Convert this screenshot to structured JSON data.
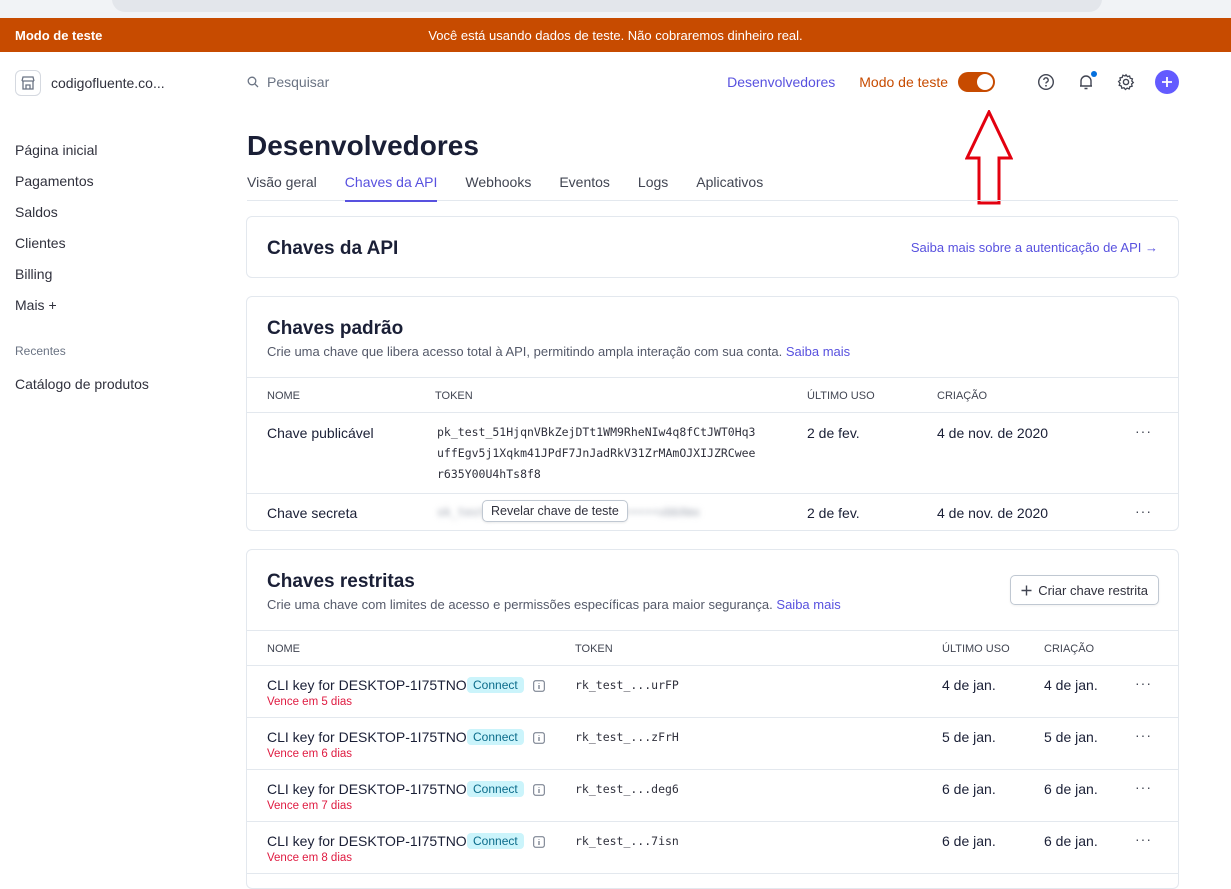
{
  "banner": {
    "label": "Modo de teste",
    "message": "Você está usando dados de teste. Não cobraremos dinheiro real."
  },
  "account": {
    "name": "codigofluente.co..."
  },
  "sidebar": {
    "items": [
      {
        "label": "Página inicial"
      },
      {
        "label": "Pagamentos"
      },
      {
        "label": "Saldos"
      },
      {
        "label": "Clientes"
      },
      {
        "label": "Billing"
      },
      {
        "label": "Mais +"
      }
    ],
    "recent_heading": "Recentes",
    "recent_items": [
      {
        "label": "Catálogo de produtos"
      }
    ]
  },
  "topbar": {
    "search_placeholder": "Pesquisar",
    "developers_link": "Desenvolvedores",
    "test_mode_label": "Modo de teste",
    "test_mode_on": true
  },
  "page": {
    "title": "Desenvolvedores",
    "tabs": [
      {
        "label": "Visão geral",
        "active": false
      },
      {
        "label": "Chaves da API",
        "active": true
      },
      {
        "label": "Webhooks",
        "active": false
      },
      {
        "label": "Eventos",
        "active": false
      },
      {
        "label": "Logs",
        "active": false
      },
      {
        "label": "Aplicativos",
        "active": false
      }
    ]
  },
  "api_card": {
    "title": "Chaves da API",
    "link": "Saiba mais sobre a autenticação de API →"
  },
  "standard_keys": {
    "title": "Chaves padrão",
    "description": "Crie uma chave que libera acesso total à API, permitindo ampla interação com sua conta.",
    "learn_more": "Saiba mais",
    "columns": {
      "name": "NOME",
      "token": "TOKEN",
      "last_used": "ÚLTIMO USO",
      "created": "CRIAÇÃO"
    },
    "rows": [
      {
        "name": "Chave publicável",
        "token_lines": [
          "pk_test_51HjqnVBkZejDTt1WM9RheNIw4q8fCtJWT0Hq3",
          "uffEgv5j1Xqkm41JPdF7JnJadRkV31ZrMAmOJXIJZRCwee",
          "r635Y00U4hTs8f8"
        ],
        "last_used": "2 de fev.",
        "created": "4 de nov. de 2020",
        "menu": "···"
      },
      {
        "name": "Chave secreta",
        "token_blurred": "sk_test_••••••••••••••••••••••••xbbXmx",
        "reveal_label": "Revelar chave de teste",
        "last_used": "2 de fev.",
        "created": "4 de nov. de 2020",
        "menu": "···"
      }
    ]
  },
  "restricted_keys": {
    "title": "Chaves restritas",
    "description": "Crie uma chave com limites de acesso e permissões específicas para maior segurança.",
    "learn_more": "Saiba mais",
    "create_label": "Criar chave restrita",
    "columns": {
      "name": "NOME",
      "token": "TOKEN",
      "last_used": "ÚLTIMO USO",
      "created": "CRIAÇÃO"
    },
    "rows": [
      {
        "name": "CLI key for DESKTOP-1I75TNO",
        "badge": "Connect",
        "expires": "Vence em 5 dias",
        "token": "rk_test_...urFP",
        "last_used": "4 de jan.",
        "created": "4 de jan.",
        "menu": "···"
      },
      {
        "name": "CLI key for DESKTOP-1I75TNO",
        "badge": "Connect",
        "expires": "Vence em 6 dias",
        "token": "rk_test_...zFrH",
        "last_used": "5 de jan.",
        "created": "5 de jan.",
        "menu": "···"
      },
      {
        "name": "CLI key for DESKTOP-1I75TNO",
        "badge": "Connect",
        "expires": "Vence em 7 dias",
        "token": "rk_test_...deg6",
        "last_used": "6 de jan.",
        "created": "6 de jan.",
        "menu": "···"
      },
      {
        "name": "CLI key for DESKTOP-1I75TNO",
        "badge": "Connect",
        "expires": "Vence em 8 dias",
        "token": "rk_test_...7isn",
        "last_used": "6 de jan.",
        "created": "6 de jan.",
        "menu": "···"
      }
    ]
  },
  "colors": {
    "test_mode": "#c74b00",
    "accent": "#5851df",
    "plus_button": "#635bff",
    "expire_text": "#df1b41",
    "badge_bg": "#cbf4fb",
    "annotation_arrow": "#e3000f"
  },
  "icons": [
    "store-icon",
    "search-icon",
    "toggle-switch",
    "help-icon",
    "bell-icon",
    "gear-icon",
    "plus-icon",
    "info-icon",
    "more-dots-icon",
    "red-annotation-arrow"
  ]
}
